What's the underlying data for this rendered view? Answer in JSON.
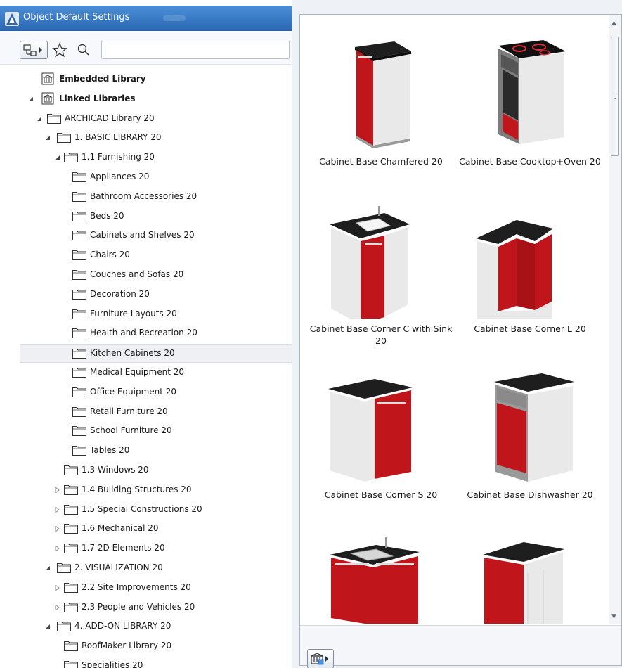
{
  "window": {
    "title": "Object Default Settings",
    "accent": "#2f6dbb"
  },
  "toolbar": {
    "view_icon": "tree-view-icon",
    "favorites_icon": "star-icon",
    "search_icon": "magnifier-icon",
    "search_value": ""
  },
  "tree": [
    {
      "label": "Embedded Library",
      "bold": true,
      "level": 0,
      "toggle": "none",
      "icon": "library"
    },
    {
      "label": "Linked Libraries",
      "bold": true,
      "level": 0,
      "toggle": "expanded",
      "icon": "library"
    },
    {
      "label": "ARCHICAD Library 20",
      "level": 1,
      "toggle": "expanded",
      "icon": "folder"
    },
    {
      "label": "1. BASIC LIBRARY 20",
      "level": 2,
      "toggle": "expanded",
      "icon": "folder"
    },
    {
      "label": "1.1 Furnishing 20",
      "level": 3,
      "toggle": "expanded",
      "icon": "folder"
    },
    {
      "label": "Appliances 20",
      "level": 4,
      "toggle": "none",
      "icon": "folder"
    },
    {
      "label": "Bathroom Accessories 20",
      "level": 4,
      "toggle": "none",
      "icon": "folder"
    },
    {
      "label": "Beds 20",
      "level": 4,
      "toggle": "none",
      "icon": "folder"
    },
    {
      "label": "Cabinets and Shelves 20",
      "level": 4,
      "toggle": "none",
      "icon": "folder"
    },
    {
      "label": "Chairs 20",
      "level": 4,
      "toggle": "none",
      "icon": "folder"
    },
    {
      "label": "Couches and Sofas 20",
      "level": 4,
      "toggle": "none",
      "icon": "folder"
    },
    {
      "label": "Decoration 20",
      "level": 4,
      "toggle": "none",
      "icon": "folder"
    },
    {
      "label": "Furniture Layouts 20",
      "level": 4,
      "toggle": "none",
      "icon": "folder"
    },
    {
      "label": "Health and Recreation 20",
      "level": 4,
      "toggle": "none",
      "icon": "folder"
    },
    {
      "label": "Kitchen Cabinets 20",
      "level": 4,
      "toggle": "none",
      "icon": "folder",
      "selected": true
    },
    {
      "label": "Medical Equipment 20",
      "level": 4,
      "toggle": "none",
      "icon": "folder"
    },
    {
      "label": "Office Equipment 20",
      "level": 4,
      "toggle": "none",
      "icon": "folder"
    },
    {
      "label": "Retail Furniture 20",
      "level": 4,
      "toggle": "none",
      "icon": "folder"
    },
    {
      "label": "School Furniture 20",
      "level": 4,
      "toggle": "none",
      "icon": "folder"
    },
    {
      "label": "Tables 20",
      "level": 4,
      "toggle": "none",
      "icon": "folder"
    },
    {
      "label": "1.3 Windows 20",
      "level": 3,
      "toggle": "none",
      "icon": "folder"
    },
    {
      "label": "1.4 Building Structures 20",
      "level": 3,
      "toggle": "collapsed",
      "icon": "folder"
    },
    {
      "label": "1.5 Special Constructions 20",
      "level": 3,
      "toggle": "collapsed",
      "icon": "folder"
    },
    {
      "label": "1.6 Mechanical 20",
      "level": 3,
      "toggle": "collapsed",
      "icon": "folder"
    },
    {
      "label": "1.7 2D Elements 20",
      "level": 3,
      "toggle": "collapsed",
      "icon": "folder"
    },
    {
      "label": "2. VISUALIZATION 20",
      "level": 2,
      "toggle": "expanded",
      "icon": "folder"
    },
    {
      "label": "2.2 Site Improvements 20",
      "level": 3,
      "toggle": "collapsed",
      "icon": "folder"
    },
    {
      "label": "2.3 People and Vehicles 20",
      "level": 3,
      "toggle": "collapsed",
      "icon": "folder"
    },
    {
      "label": "4. ADD-ON LIBRARY 20",
      "level": 2,
      "toggle": "expanded",
      "icon": "folder"
    },
    {
      "label": "RoofMaker Library 20",
      "level": 3,
      "toggle": "none",
      "icon": "folder"
    },
    {
      "label": "Specialities 20",
      "level": 3,
      "toggle": "none",
      "icon": "folder"
    }
  ],
  "objects": [
    {
      "name": "Cabinet Base Chamfered 20",
      "thumb": "chamfered"
    },
    {
      "name": "Cabinet Base Cooktop+Oven 20",
      "thumb": "cooktop-oven"
    },
    {
      "name": "Cabinet Base Corner C with Sink 20",
      "thumb": "corner-c-sink"
    },
    {
      "name": "Cabinet Base Corner L 20",
      "thumb": "corner-l"
    },
    {
      "name": "Cabinet Base Corner S 20",
      "thumb": "corner-s"
    },
    {
      "name": "Cabinet Base Dishwasher 20",
      "thumb": "dishwasher"
    },
    {
      "name": "",
      "thumb": "double-sink"
    },
    {
      "name": "",
      "thumb": "tall-double"
    }
  ],
  "bottom": {
    "library_manager_icon": "library-manager-icon"
  },
  "colors": {
    "cabinet_red": "#c0161b",
    "countertop": "#1e1e1e",
    "carcass": "#e9e9e9",
    "selected_row": "#eef0f3"
  }
}
